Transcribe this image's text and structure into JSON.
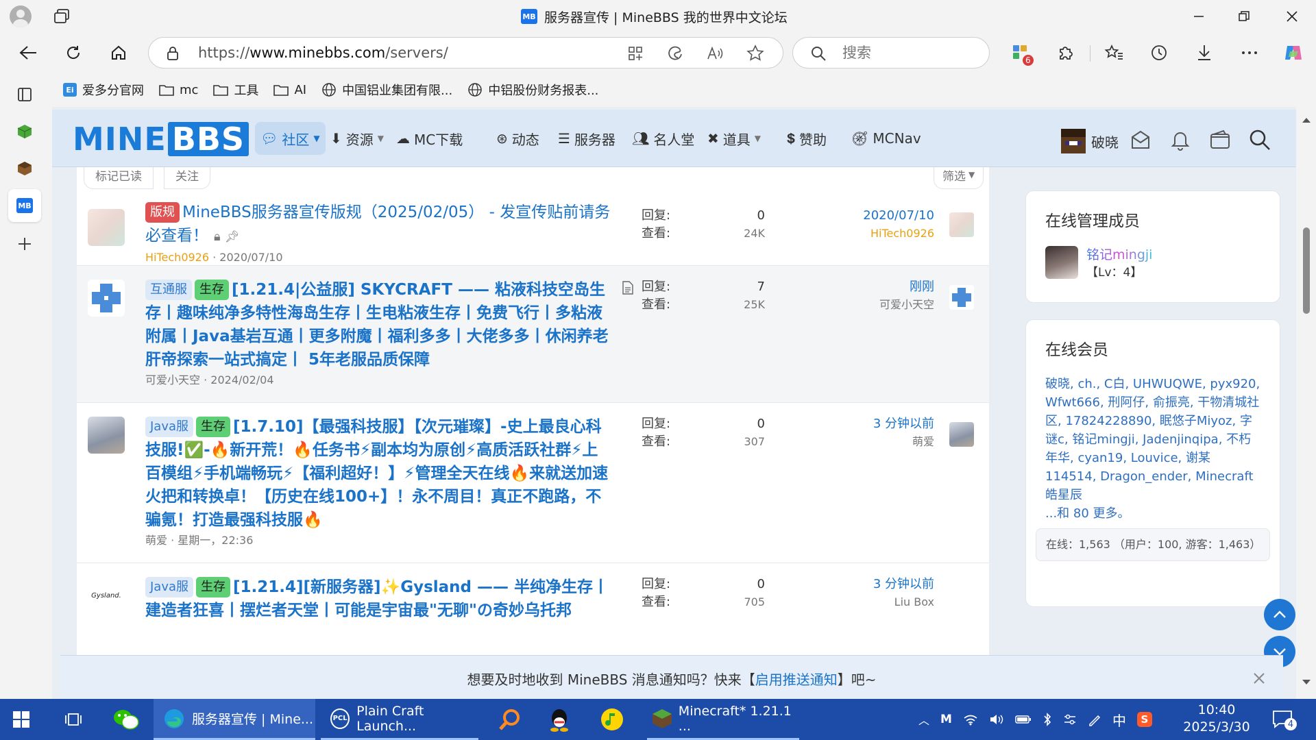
{
  "window": {
    "tab_title": "服务器宣传 | MineBBS 我的世界中文论坛",
    "favicon_text": "MB"
  },
  "address": {
    "url_prefix": "https://",
    "url_host": "www.minebbs.com",
    "url_path": "/servers/",
    "search_placeholder": "搜索",
    "ext_badge": "6"
  },
  "bookmarks": [
    {
      "label": "爱多分官网",
      "icon": "ai-duo-icon"
    },
    {
      "label": "mc",
      "icon": "folder-icon"
    },
    {
      "label": "工具",
      "icon": "folder-icon"
    },
    {
      "label": "AI",
      "icon": "folder-icon"
    },
    {
      "label": "中国铝业集团有限...",
      "icon": "globe-icon"
    },
    {
      "label": "中铝股份财务报表...",
      "icon": "globe-icon"
    }
  ],
  "site": {
    "logo_part1": "MINE",
    "logo_part2": "BBS",
    "nav": [
      {
        "label": "社区",
        "dropdown": true,
        "active": true
      },
      {
        "label": "资源",
        "dropdown": true
      },
      {
        "label": "MC下载"
      },
      {
        "label": "动态"
      },
      {
        "label": "服务器"
      },
      {
        "label": "名人堂"
      },
      {
        "label": "道具",
        "dropdown": true
      },
      {
        "label": "赞助"
      },
      {
        "label": "MCNav"
      }
    ],
    "username": "破晓"
  },
  "filters": {
    "mark_read": "标记已读",
    "follow": "关注",
    "filter": "筛选"
  },
  "stat_labels": {
    "replies": "回复:",
    "views": "查看:"
  },
  "threads": [
    {
      "tags": [
        {
          "text": "版规",
          "style": "red"
        }
      ],
      "title": "MineBBS服务器宣传版规（2025/02/05） - 发宣传贴前请务必查看！",
      "author": "HiTech0926",
      "date": "2020/07/10",
      "replies": "0",
      "views": "24K",
      "last_date": "2020/07/10",
      "last_user": "HiTech0926"
    },
    {
      "tags": [
        {
          "text": "互通服",
          "style": "blue"
        },
        {
          "text": "生存",
          "style": "green"
        }
      ],
      "title": "[1.21.4|公益服] SKYCRAFT —— 粘液科技空岛生存丨趣味纯净多特性海岛生存丨生电粘液生存丨免费飞行丨多粘液附属丨Java基岩互通丨更多附魔丨福利多多丨大佬多多丨休闲养老肝帝探索一站式搞定丨 5年老服品质保障",
      "author": "可爱小天空",
      "date": "2024/02/04",
      "replies": "7",
      "views": "25K",
      "last_date": "刚刚",
      "last_user": "可爱小天空"
    },
    {
      "tags": [
        {
          "text": "Java服",
          "style": "blue"
        },
        {
          "text": "生存",
          "style": "green"
        }
      ],
      "title": "[1.7.10]【最强科技服】【次元璀璨】-史上最良心科技服!✅-🔥新开荒！🔥任务书⚡副本均为原创⚡高质活跃社群⚡上百模组⚡手机端畅玩⚡【福利超好！】⚡管理全天在线🔥来就送加速火把和转换卓！【历史在线100+】！永不周目！真正不跑路，不骗氪！打造最强科技服🔥",
      "author": "萌爱",
      "date": "星期一，22:36",
      "replies": "0",
      "views": "307",
      "last_date": "3 分钟以前",
      "last_user": "萌爱"
    },
    {
      "tags": [
        {
          "text": "Java服",
          "style": "blue"
        },
        {
          "text": "生存",
          "style": "green"
        }
      ],
      "title": "[1.21.4][新服务器]✨Gysland —— 半纯净生存丨建造者狂喜丨摆烂者天堂丨可能是宇宙最\"无聊\"の奇妙乌托邦",
      "author": "Liu Box",
      "date": "",
      "replies": "0",
      "views": "705",
      "last_date": "3 分钟以前",
      "last_user": "Liu Box",
      "avatar_text": "Gysland."
    }
  ],
  "sidebar": {
    "staff_title": "在线管理成员",
    "staff": [
      {
        "name": "铭记mingji",
        "level": "【Lv：4】"
      }
    ],
    "members_title": "在线会员",
    "members_text": "破晓, ch., C白, UHWUQWE, pyx920, Wfwt666, 刑阿仔, 俞振亮, 干物清城社区, 17824228890, 眠悠子Miyoz, 字谜c, 铭记mingji, Jadenjinqipa, 不朽年华, cyan19, Louvice, 谢某114514, Dragon_ender, Minecraft皓星辰",
    "more": "...和 80 更多。",
    "online_stats": "在线：1,563 （用户：100, 游客：1,463）"
  },
  "notice": {
    "before": "想要及时地收到 MineBBS 消息通知吗？快来【",
    "link": "启用推送通知",
    "after": "】吧~"
  },
  "taskbar": {
    "items": [
      {
        "label": "服务器宣传 | Mine...",
        "active": true
      },
      {
        "label": "Plain Craft Launch..."
      },
      {
        "label": "Minecraft* 1.21.1 ..."
      }
    ],
    "ime": "中",
    "time": "10:40",
    "date": "2025/3/30",
    "notif_count": "4"
  },
  "colors": {
    "accent": "#1a73c9",
    "taskbar": "#1d4ba8",
    "tag_red": "#e05252",
    "tag_green": "#5fcf76"
  }
}
